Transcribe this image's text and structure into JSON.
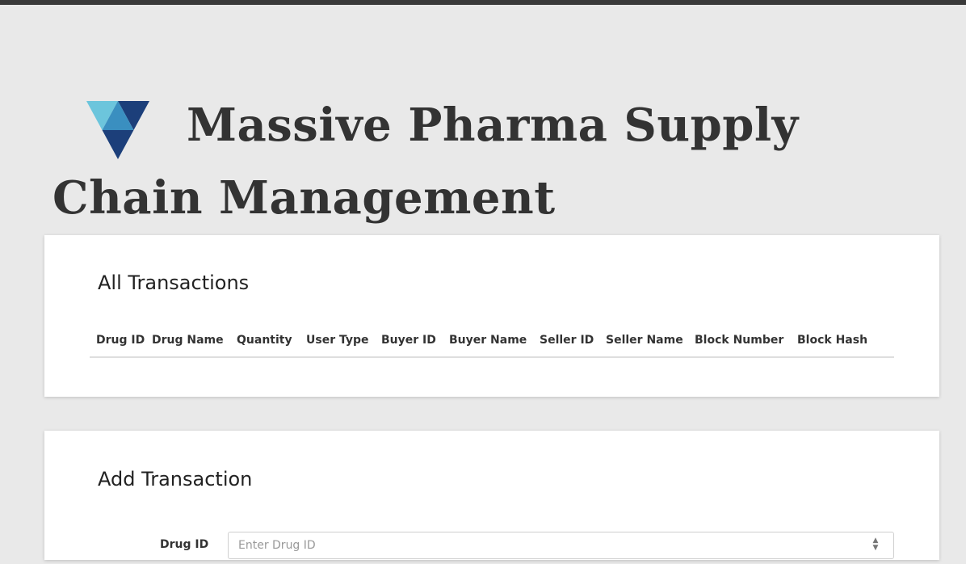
{
  "header": {
    "title": "Massive Pharma Supply Chain Management"
  },
  "transactions_card": {
    "title": "All Transactions",
    "columns": [
      "Drug ID",
      "Drug Name",
      "Quantity",
      "User Type",
      "Buyer ID",
      "Buyer Name",
      "Seller ID",
      "Seller Name",
      "Block Number",
      "Block Hash"
    ]
  },
  "add_card": {
    "title": "Add Transaction",
    "drug_id_label": "Drug ID",
    "drug_id_placeholder": "Enter Drug ID",
    "drug_id_value": ""
  },
  "colors": {
    "logo_light": "#6cc5dc",
    "logo_mid": "#3a8fc0",
    "logo_dark": "#1c3f7a",
    "page_bg": "#e9e9e9",
    "topbar": "#3a3a3a"
  },
  "icons": {
    "logo": "triangle-logo-icon",
    "spinner": "number-spinner-icon"
  }
}
